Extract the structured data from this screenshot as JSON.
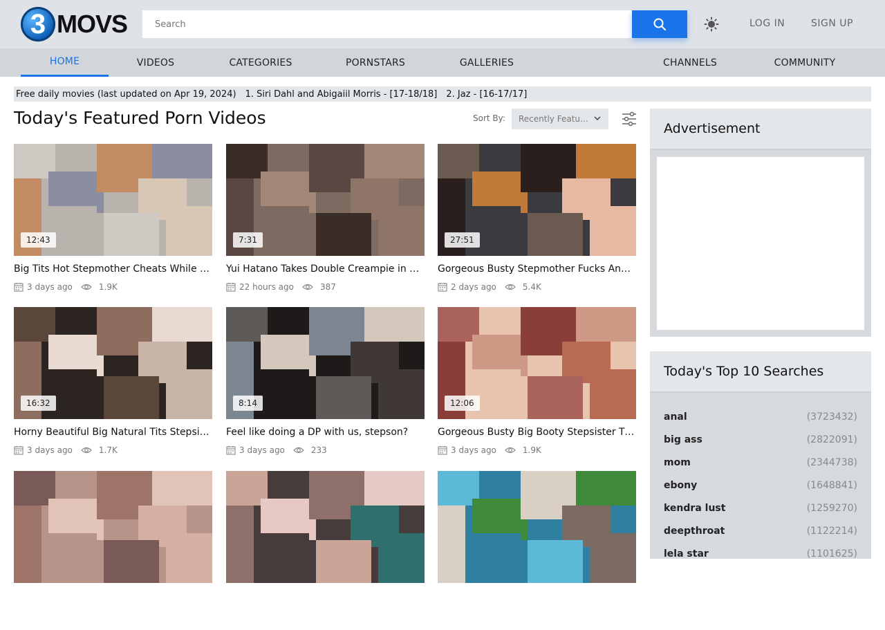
{
  "header": {
    "logo_digit": "3",
    "logo_text": "MOVS",
    "search_placeholder": "Search",
    "login": "LOG IN",
    "signup": "SIGN UP",
    "accent": "#1a73e8"
  },
  "nav": {
    "items": [
      {
        "label": "HOME",
        "active": true
      },
      {
        "label": "VIDEOS"
      },
      {
        "label": "CATEGORIES"
      },
      {
        "label": "PORNSTARS"
      },
      {
        "label": "GALLERIES"
      },
      {
        "label": "CHANNELS"
      },
      {
        "label": "COMMUNITY"
      }
    ]
  },
  "ticker": {
    "lead": "Free daily movies (last updated on Apr 19, 2024)",
    "items": [
      "1. Siri Dahl and Abigaiil Morris - [17-18/18]",
      "2. Jaz - [16-17/17]"
    ]
  },
  "main": {
    "title": "Today's Featured Porn Videos",
    "sort_label": "Sort By:",
    "sort_value": "Recently Featured"
  },
  "videos": [
    {
      "duration": "12:43",
      "title": "Big Tits Hot Stepmother Cheats While On Vacation",
      "age": "3 days ago",
      "views": "1.9K",
      "colors": [
        "#b9b3ad",
        "#cfc9c4",
        "#8a8ea0",
        "#c38b62",
        "#d9c7b5"
      ]
    },
    {
      "duration": "7:31",
      "title": "Yui Hatano Takes Double Creampie in Hot Threesome",
      "age": "22 hours ago",
      "views": "387",
      "colors": [
        "#7d6a60",
        "#3a2c27",
        "#a38878",
        "#5a4742",
        "#8f7468"
      ]
    },
    {
      "duration": "27:51",
      "title": "Gorgeous Busty Stepmother Fucks And Sucks",
      "age": "2 days ago",
      "views": "5.4K",
      "colors": [
        "#3b3a3e",
        "#6b5a50",
        "#c27a3a",
        "#2a1f1d",
        "#e8b9a2"
      ]
    },
    {
      "duration": "16:32",
      "title": "Horny Beautiful Big Natural Tits Stepsister Rides",
      "age": "3 days ago",
      "views": "1.7K",
      "colors": [
        "#2c2420",
        "#5a463b",
        "#e9dad1",
        "#8d6d5e",
        "#c9b4a8"
      ]
    },
    {
      "duration": "8:14",
      "title": "Feel like doing a DP with us, stepson?",
      "age": "3 days ago",
      "views": "233",
      "colors": [
        "#1d1a19",
        "#5e5a58",
        "#d4c8bd",
        "#7c8690",
        "#3f3834"
      ]
    },
    {
      "duration": "12:06",
      "title": "Gorgeous Busty Big Booty Stepsister Tight Pussy",
      "age": "3 days ago",
      "views": "1.9K",
      "colors": [
        "#e8c4ae",
        "#a9625c",
        "#cf9a85",
        "#8a3e3a",
        "#b86a52"
      ]
    },
    {
      "duration": "",
      "title": "",
      "age": "",
      "views": "",
      "colors": [
        "#b7948a",
        "#7a5a56",
        "#e1c3b7",
        "#9f7468",
        "#d5b0a2"
      ]
    },
    {
      "duration": "",
      "title": "",
      "age": "",
      "views": "",
      "colors": [
        "#463c3b",
        "#c9a497",
        "#e6c9c4",
        "#8f6f6a",
        "#2f6f6d"
      ]
    },
    {
      "duration": "",
      "title": "",
      "age": "",
      "views": "",
      "colors": [
        "#2f7fa1",
        "#5cb9d8",
        "#3e8a3a",
        "#d9cfc3",
        "#7d6a62"
      ]
    }
  ],
  "sidebar": {
    "ad_title": "Advertisement",
    "top_title": "Today's Top 10 Searches",
    "searches": [
      {
        "term": "anal",
        "count": "(3723432)"
      },
      {
        "term": "big ass",
        "count": "(2822091)"
      },
      {
        "term": "mom",
        "count": "(2344738)"
      },
      {
        "term": "ebony",
        "count": "(1648841)"
      },
      {
        "term": "kendra lust",
        "count": "(1259270)"
      },
      {
        "term": "deepthroat",
        "count": "(1122214)"
      },
      {
        "term": "lela star",
        "count": "(1101625)"
      }
    ]
  }
}
